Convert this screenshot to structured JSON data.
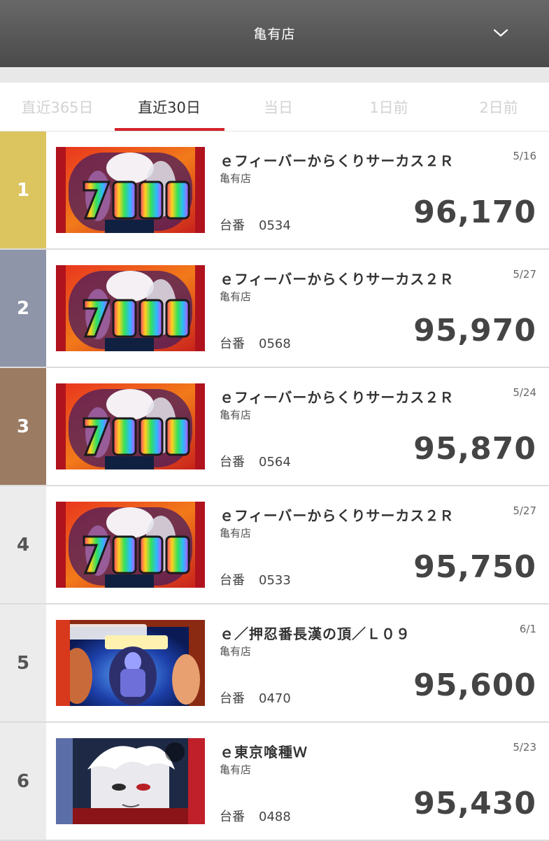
{
  "header": {
    "title": "亀有店",
    "dropdown_icon": "chevron-down-icon"
  },
  "tabs": [
    {
      "label": "直近365日",
      "active": false
    },
    {
      "label": "直近30日",
      "active": true
    },
    {
      "label": "当日",
      "active": false
    },
    {
      "label": "1日前",
      "active": false
    },
    {
      "label": "2日前",
      "active": false
    }
  ],
  "colors": {
    "accent": "#d3242b",
    "rank_gold": "#dcc45f",
    "rank_silver": "#8e95a8",
    "rank_bronze": "#9c7b63",
    "rank_plain": "#ececec"
  },
  "unit_label": "台番",
  "ranking": [
    {
      "rank": "1",
      "machine": "ｅフィーバーからくりサーカス２Ｒ",
      "store": "亀有店",
      "date": "5/16",
      "unit": "0534",
      "score": "96,170",
      "thumb": "karakuri"
    },
    {
      "rank": "2",
      "machine": "ｅフィーバーからくりサーカス２Ｒ",
      "store": "亀有店",
      "date": "5/27",
      "unit": "0568",
      "score": "95,970",
      "thumb": "karakuri"
    },
    {
      "rank": "3",
      "machine": "ｅフィーバーからくりサーカス２Ｒ",
      "store": "亀有店",
      "date": "5/24",
      "unit": "0564",
      "score": "95,870",
      "thumb": "karakuri"
    },
    {
      "rank": "4",
      "machine": "ｅフィーバーからくりサーカス２Ｒ",
      "store": "亀有店",
      "date": "5/27",
      "unit": "0533",
      "score": "95,750",
      "thumb": "karakuri"
    },
    {
      "rank": "5",
      "machine": "ｅ／押忍番長漢の頂／Ｌ０９",
      "store": "亀有店",
      "date": "6/1",
      "unit": "0470",
      "score": "95,600",
      "thumb": "osu"
    },
    {
      "rank": "6",
      "machine": "ｅ東京喰種Ｗ",
      "store": "亀有店",
      "date": "5/23",
      "unit": "0488",
      "score": "95,430",
      "thumb": "ghoul"
    }
  ]
}
